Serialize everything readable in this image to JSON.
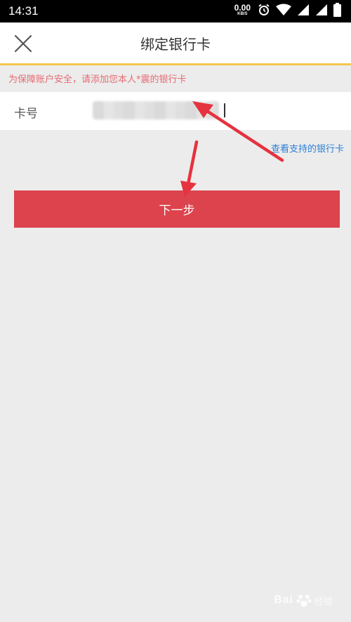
{
  "status_bar": {
    "time": "14:31",
    "speed_value": "0.00",
    "speed_unit": "KB/S",
    "icons": [
      "alarm-icon",
      "wifi-icon",
      "signal-icon",
      "signal-icon",
      "battery-icon"
    ]
  },
  "navbar": {
    "title": "绑定银行卡",
    "close_icon": "close-icon"
  },
  "notice": {
    "text": "为保障账户安全，请添加您本人*震的银行卡"
  },
  "card_form": {
    "label": "卡号",
    "value": ""
  },
  "support_link": {
    "label": "查看支持的银行卡"
  },
  "next_button": {
    "label": "下一步"
  },
  "watermark": {
    "text": "Bai",
    "sub": "经验"
  },
  "colors": {
    "accent_red": "#dc434c",
    "notice_text": "#e56b73",
    "link_blue": "#2d7fd6",
    "divider_yellow": "#f3c64b",
    "annotation_arrow": "#e5333f"
  }
}
